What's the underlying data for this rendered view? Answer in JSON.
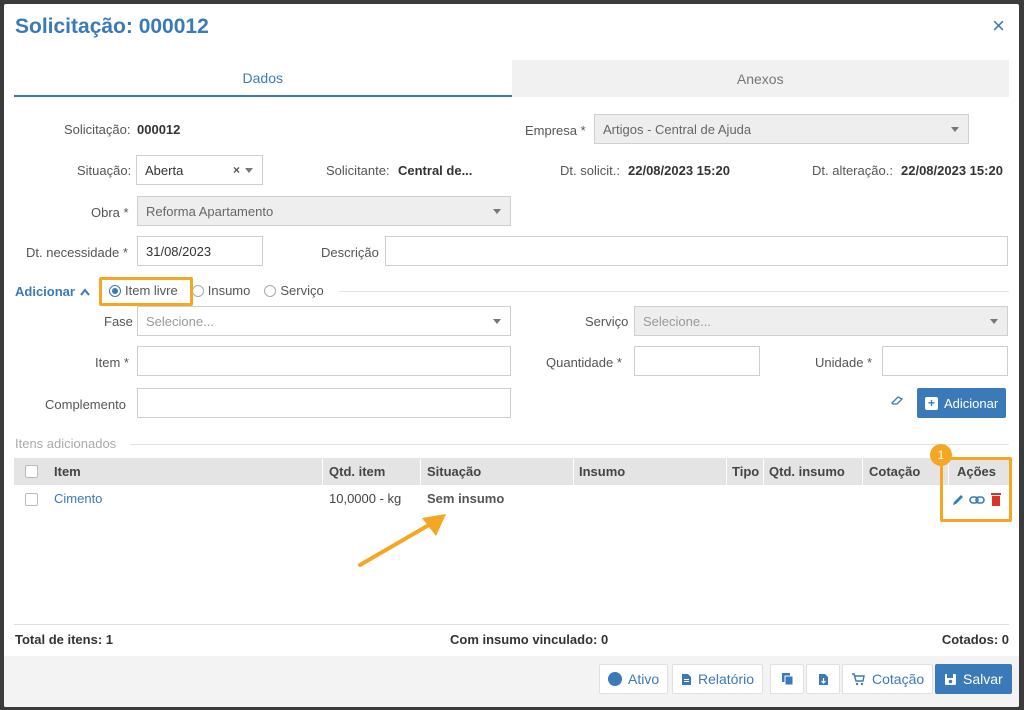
{
  "modal": {
    "title": "Solicitação: 000012",
    "close_label": "×"
  },
  "tabs": [
    {
      "label": "Dados"
    },
    {
      "label": "Anexos"
    }
  ],
  "form": {
    "solicitacao_label": "Solicitação:",
    "solicitacao_value": "000012",
    "empresa_label": "Empresa *",
    "empresa_value": "Artigos - Central de Ajuda",
    "situacao_label": "Situação:",
    "situacao_value": "Aberta",
    "solicitante_label": "Solicitante:",
    "solicitante_value": "Central de...",
    "dt_solicit_label": "Dt. solicit.:",
    "dt_solicit_value": "22/08/2023 15:20",
    "dt_alteracao_label": "Dt. alteração.:",
    "dt_alteracao_value": "22/08/2023 15:20",
    "obra_label": "Obra *",
    "obra_value": "Reforma Apartamento",
    "dt_necessidade_label": "Dt. necessidade *",
    "dt_necessidade_value": "31/08/2023",
    "descricao_label": "Descrição",
    "descricao_value": ""
  },
  "adicionar": {
    "label": "Adicionar",
    "radios": [
      {
        "label": "Item livre"
      },
      {
        "label": "Insumo"
      },
      {
        "label": "Serviço"
      }
    ],
    "selected": "Item livre",
    "fase_label": "Fase",
    "fase_placeholder": "Selecione...",
    "servico_label": "Serviço",
    "servico_placeholder": "Selecione...",
    "item_label": "Item *",
    "quantidade_label": "Quantidade *",
    "unidade_label": "Unidade *",
    "complemento_label": "Complemento",
    "add_button": "Adicionar"
  },
  "items": {
    "title": "Itens adicionados",
    "columns": [
      "Item",
      "Qtd. item",
      "Situação",
      "Insumo",
      "Tipo",
      "Qtd. insumo",
      "Cotação",
      "Ações"
    ],
    "rows": [
      {
        "item": "Cimento",
        "qtd": "10,0000 - kg",
        "situacao": "Sem insumo",
        "insumo": "",
        "tipo": "",
        "qtd_insumo": "",
        "cotacao": ""
      }
    ],
    "badge": "1"
  },
  "totals": {
    "total_itens": "Total de itens: 1",
    "com_insumo": "Com insumo vinculado: 0",
    "cotados": "Cotados: 0"
  },
  "actions": {
    "ativo": "Ativo",
    "relatorio": "Relatório",
    "cotacao": "Cotação",
    "salvar": "Salvar"
  },
  "colors": {
    "accent": "#3a7ab8",
    "highlight": "#f5a623",
    "danger": "#d9342b"
  }
}
